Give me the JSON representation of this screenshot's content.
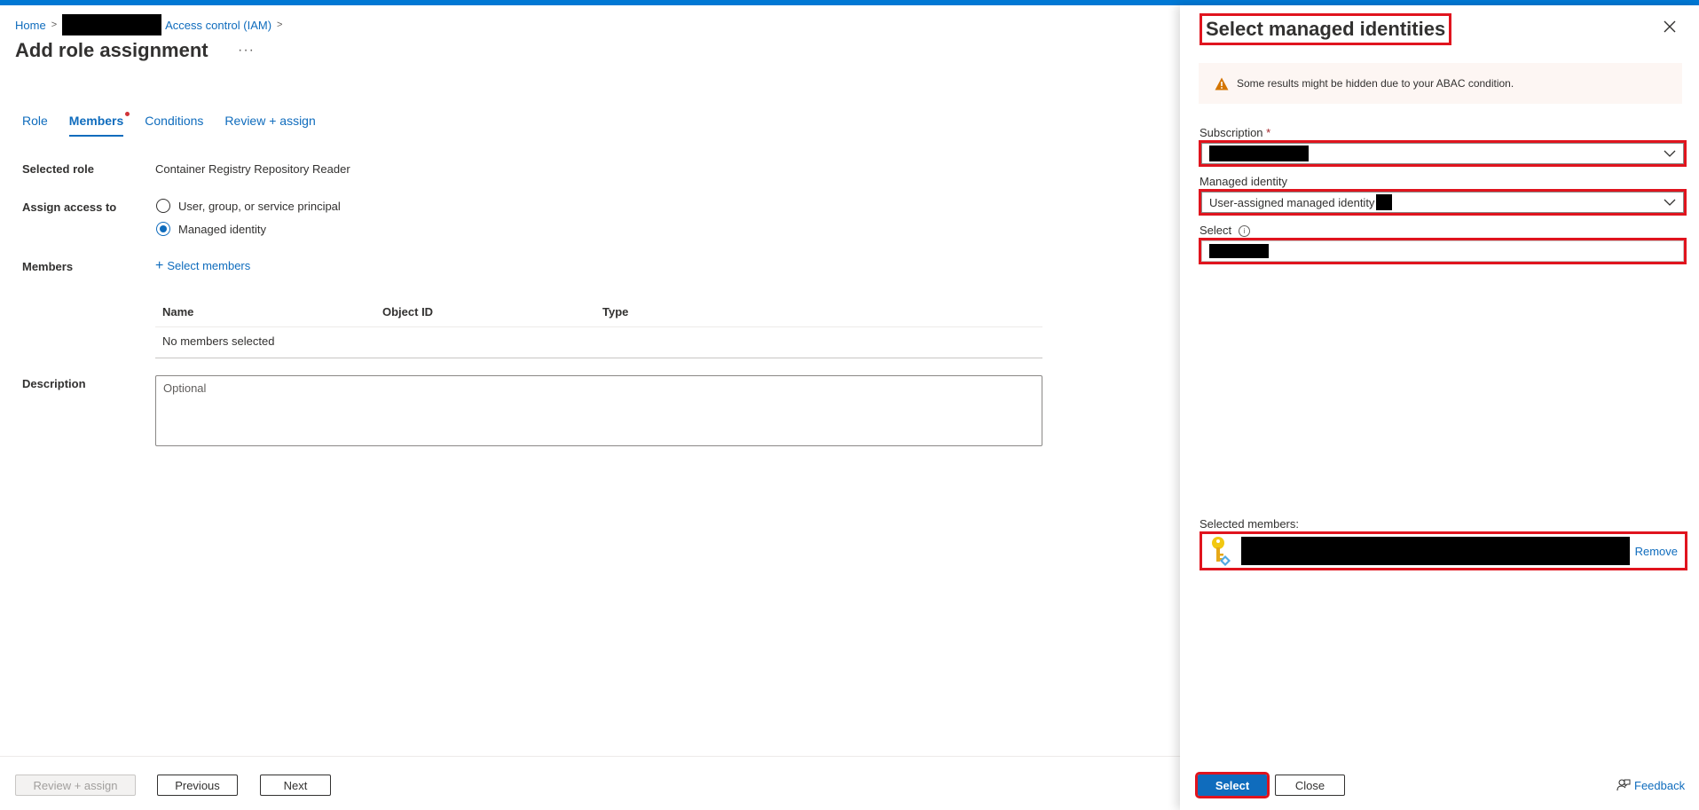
{
  "breadcrumb": {
    "home": "Home",
    "iam": "Access control (IAM)"
  },
  "page": {
    "title": "Add role assignment",
    "more": "···"
  },
  "tabs": [
    {
      "label": "Role"
    },
    {
      "label": "Members"
    },
    {
      "label": "Conditions"
    },
    {
      "label": "Review + assign"
    }
  ],
  "form": {
    "selected_role_label": "Selected role",
    "selected_role_value": "Container Registry Repository Reader",
    "assign_access_label": "Assign access to",
    "option_user": "User, group, or service principal",
    "option_managed": "Managed identity",
    "members_label": "Members",
    "select_members": "Select members",
    "table_headers": [
      "Name",
      "Object ID",
      "Type"
    ],
    "no_members": "No members selected",
    "description_label": "Description",
    "description_placeholder": "Optional"
  },
  "footer": {
    "review_assign": "Review + assign",
    "previous": "Previous",
    "next": "Next"
  },
  "panel": {
    "title": "Select managed identities",
    "warning": "Some results might be hidden due to your ABAC condition.",
    "subscription_label": "Subscription",
    "required_mark": "*",
    "managed_identity_label": "Managed identity",
    "managed_identity_value": "User-assigned managed identity",
    "select_label": "Select",
    "selected_members_label": "Selected members:",
    "remove": "Remove",
    "select_button": "Select",
    "close_button": "Close",
    "feedback": "Feedback"
  },
  "colors": {
    "accent": "#0f6cbd",
    "top_bar": "#0078d4",
    "highlight": "#e0141e",
    "warning": "#d47500"
  }
}
